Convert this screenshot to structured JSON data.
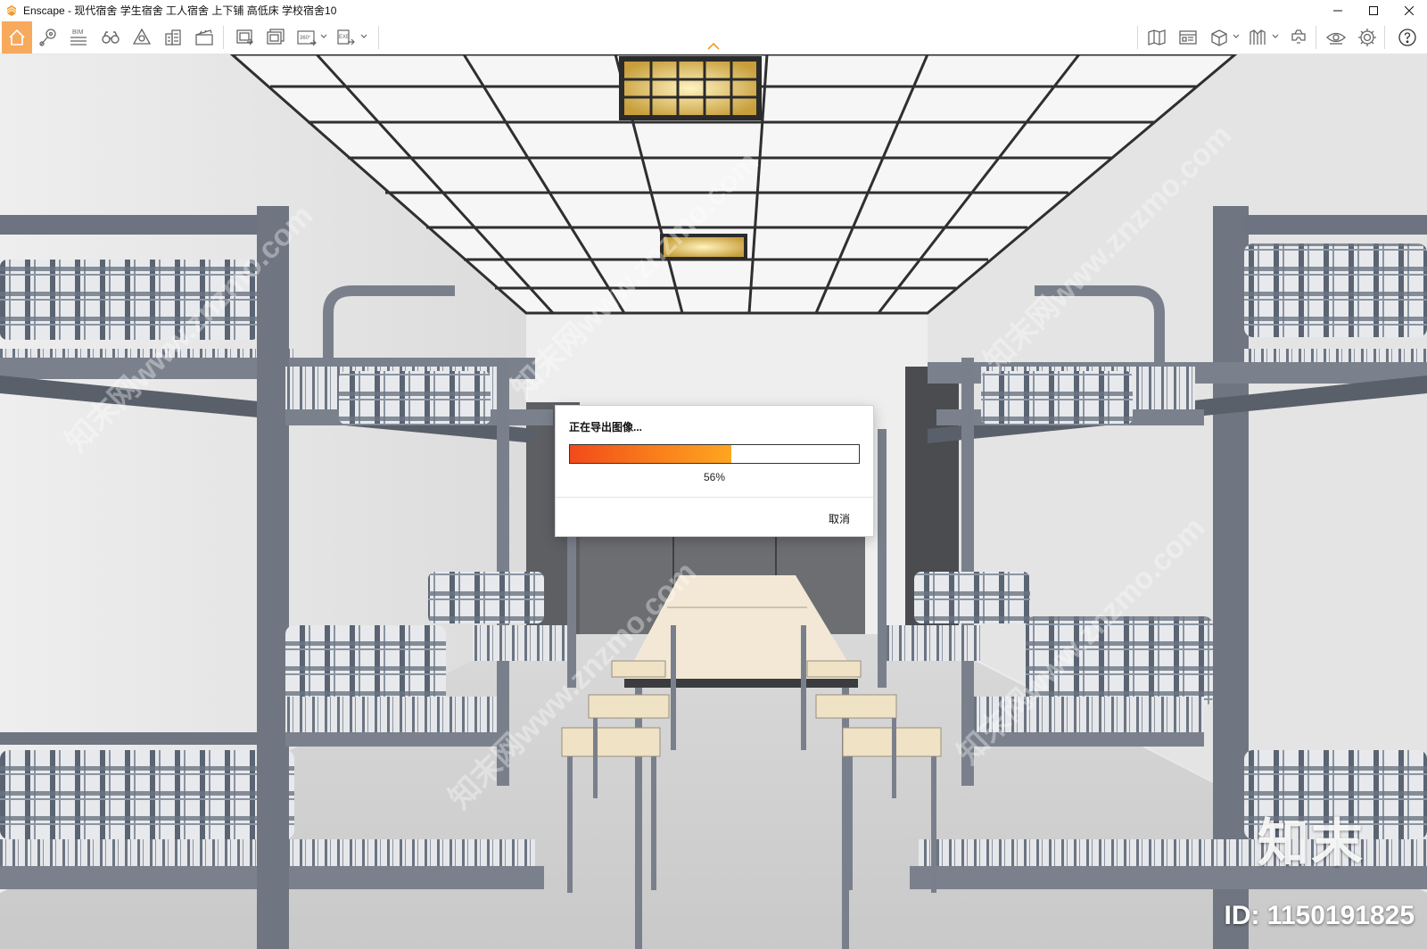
{
  "window": {
    "title": "Enscape - 现代宿舍 学生宿舍 工人宿舍 上下铺 高低床 学校宿舍10",
    "controls": [
      "minimize-icon",
      "maximize-icon",
      "close-icon"
    ]
  },
  "toolbar": {
    "left_icons": [
      "home-icon",
      "location-pin-icon",
      "bim-icon",
      "binoculars-icon",
      "atmosphere-icon",
      "building-icon",
      "clapperboard-icon",
      "render-image-icon",
      "batch-render-icon",
      "panorama-360-icon",
      "export-exe-icon"
    ],
    "bim_label": "BIM",
    "pano_label": "360°",
    "exe_label": "EXE",
    "right_icons": [
      "map-icon",
      "asset-library-icon",
      "cube-view-icon",
      "materials-icon",
      "vr-headset-icon",
      "visual-settings-icon",
      "settings-gear-icon",
      "help-icon"
    ],
    "accent": "#f7a95c"
  },
  "dialog": {
    "title": "正在导出图像...",
    "progress_fraction": 0.56,
    "progress_label": "56%",
    "cancel_label": "取消",
    "fill_colors": [
      "#f24a1a",
      "#fda621"
    ]
  },
  "watermark": {
    "logo_text": "知末",
    "id_text": "ID: 1150191825",
    "diagonal_text": "知末网www.znzmo.com"
  }
}
